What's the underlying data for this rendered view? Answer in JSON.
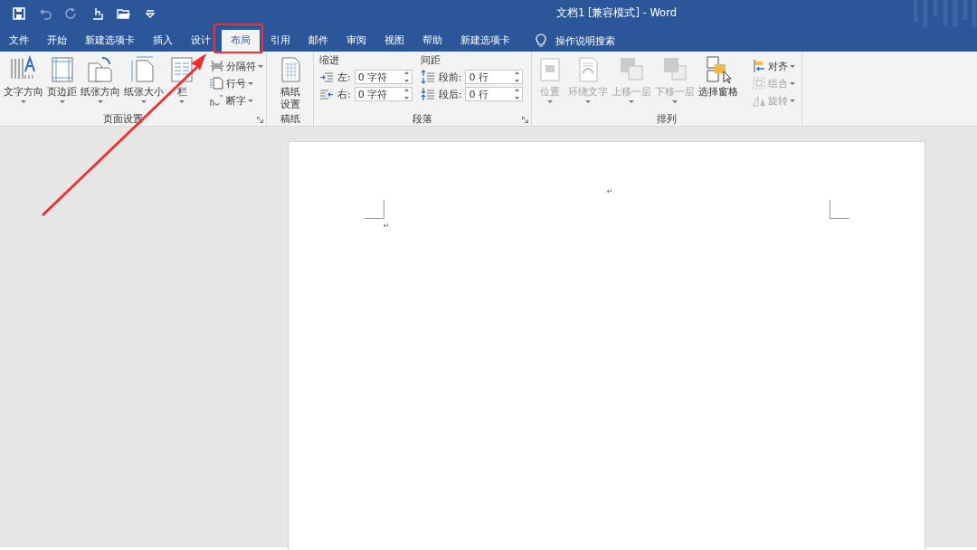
{
  "quick_access": [
    {
      "kind": "save",
      "disabled": false
    },
    {
      "kind": "undo",
      "disabled": true
    },
    {
      "kind": "redo",
      "disabled": true
    },
    {
      "kind": "touch",
      "disabled": false
    },
    {
      "kind": "open",
      "disabled": false
    },
    {
      "kind": "customize",
      "disabled": false
    }
  ],
  "window": {
    "title": "文档1 [兼容模式]  -  Word"
  },
  "tabs": [
    {
      "label": "文件",
      "selected": false
    },
    {
      "label": "开始",
      "selected": false
    },
    {
      "label": "新建选项卡",
      "selected": false
    },
    {
      "label": "插入",
      "selected": false
    },
    {
      "label": "设计",
      "selected": false
    },
    {
      "label": "布局",
      "selected": true
    },
    {
      "label": "引用",
      "selected": false
    },
    {
      "label": "邮件",
      "selected": false
    },
    {
      "label": "审阅",
      "selected": false
    },
    {
      "label": "视图",
      "selected": false
    },
    {
      "label": "帮助",
      "selected": false
    },
    {
      "label": "新建选项卡",
      "selected": false
    }
  ],
  "tell_me": {
    "label": "操作说明搜索"
  },
  "ribbon": {
    "groups": [
      {
        "label": "页面设置",
        "launcher": true,
        "items": [
          {
            "kind": "large",
            "label": "文字方向",
            "dropdown": true,
            "disabled": false
          },
          {
            "kind": "large",
            "label": "页边距",
            "dropdown": true,
            "disabled": false
          },
          {
            "kind": "large",
            "label": "纸张方向",
            "dropdown": true,
            "disabled": false
          },
          {
            "kind": "large",
            "label": "纸张大小",
            "dropdown": true,
            "disabled": false
          },
          {
            "kind": "large",
            "label": "栏",
            "dropdown": true,
            "disabled": false
          },
          {
            "kind": "small",
            "label": "分隔符",
            "dropdown": true,
            "disabled": false
          },
          {
            "kind": "small",
            "label": "行号",
            "dropdown": true,
            "disabled": false
          },
          {
            "kind": "small",
            "label": "断字",
            "dropdown": true,
            "disabled": false
          }
        ]
      },
      {
        "label": "稿纸",
        "items": [
          {
            "kind": "large",
            "label": "稿纸设置",
            "disabled": false
          }
        ]
      },
      {
        "label": "段落",
        "launcher": true,
        "items": [
          {
            "kind": "heading",
            "label": "缩进"
          },
          {
            "kind": "spin",
            "label": "左:",
            "value": "0 字符"
          },
          {
            "kind": "spin",
            "label": "右:",
            "value": "0 字符"
          },
          {
            "kind": "heading",
            "label": "间距"
          },
          {
            "kind": "spin",
            "label": "段前:",
            "value": "0 行"
          },
          {
            "kind": "spin",
            "label": "段后:",
            "value": "0 行"
          }
        ]
      },
      {
        "label": "排列",
        "items": [
          {
            "kind": "large",
            "label": "位置",
            "dropdown": true,
            "disabled": true
          },
          {
            "kind": "large",
            "label": "环绕文字",
            "dropdown": true,
            "disabled": true
          },
          {
            "kind": "large",
            "label": "上移一层",
            "dropdown": true,
            "disabled": true
          },
          {
            "kind": "large",
            "label": "下移一层",
            "dropdown": true,
            "disabled": true
          },
          {
            "kind": "large",
            "label": "选择窗格",
            "disabled": false
          },
          {
            "kind": "small",
            "label": "对齐",
            "dropdown": true,
            "disabled": false
          },
          {
            "kind": "small",
            "label": "组合",
            "dropdown": true,
            "disabled": true
          },
          {
            "kind": "small",
            "label": "旋转",
            "dropdown": true,
            "disabled": true
          }
        ]
      }
    ]
  },
  "document": {
    "paragraph_marks": [
      "↵",
      "↵"
    ]
  }
}
